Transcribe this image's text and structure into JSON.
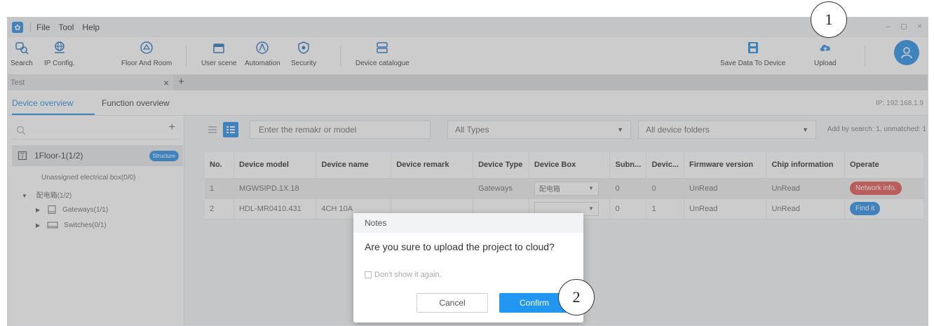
{
  "menu": [
    "File",
    "Tool",
    "Help"
  ],
  "window_controls": [
    "–",
    "◻",
    "×"
  ],
  "toolbar": {
    "search": "Search",
    "ip_config": "IP Config.",
    "floor_room": "Floor And Room",
    "user_scene": "User scene",
    "automation": "Automation",
    "security": "Security",
    "device_catalogue": "Device catalogue",
    "save_to_device": "Save Data To Device",
    "upload": "Upload"
  },
  "project_tab": {
    "name": "Test",
    "close": "×",
    "add": "+"
  },
  "overview_tabs": {
    "device": "Device overview",
    "function": "Function overview"
  },
  "ip": "IP: 192.168.1.9",
  "sidebar": {
    "add": "+",
    "floor": "1Floor-1(1/2)",
    "structure_badge": "Structure",
    "unassigned": "Unassigned electrical box(0/0)",
    "box": "配电箱(1/2)",
    "gateways": "Gateways(1/1)",
    "switches": "Switches(0/1)"
  },
  "filters": {
    "search_placeholder": "Enter the remakr or model",
    "types": "All Types",
    "folders": "All device folders",
    "add_info": "Add by search: 1, unmatched: 1"
  },
  "table": {
    "headers": [
      "No.",
      "Device model",
      "Device name",
      "Device remark",
      "Device Type",
      "Device Box",
      "Subn...",
      "Devic...",
      "Firmware version",
      "Chip information",
      "Operate"
    ],
    "rows": [
      {
        "no": "1",
        "model": "MGWSIPD.1X.18",
        "name": "",
        "remark": "",
        "type": "Gateways",
        "box": "配电箱",
        "subnet": "0",
        "device": "0",
        "firmware": "UnRead",
        "chip": "UnRead",
        "operate": "Network info."
      },
      {
        "no": "2",
        "model": "HDL-MR0410.431",
        "name": "4CH 10A",
        "remark": "",
        "type": "",
        "box": "",
        "subnet": "0",
        "device": "1",
        "firmware": "UnRead",
        "chip": "UnRead",
        "operate": "Find it"
      }
    ]
  },
  "dialog": {
    "title": "Notes",
    "message": "Are you sure to upload the project to cloud?",
    "checkbox": "Don't show it again.",
    "cancel": "Cancel",
    "confirm": "Confirm"
  },
  "callouts": [
    "1",
    "2"
  ],
  "colors": {
    "accent": "#1e88e5",
    "danger": "#e24c4c",
    "confirm": "#2196f3"
  }
}
